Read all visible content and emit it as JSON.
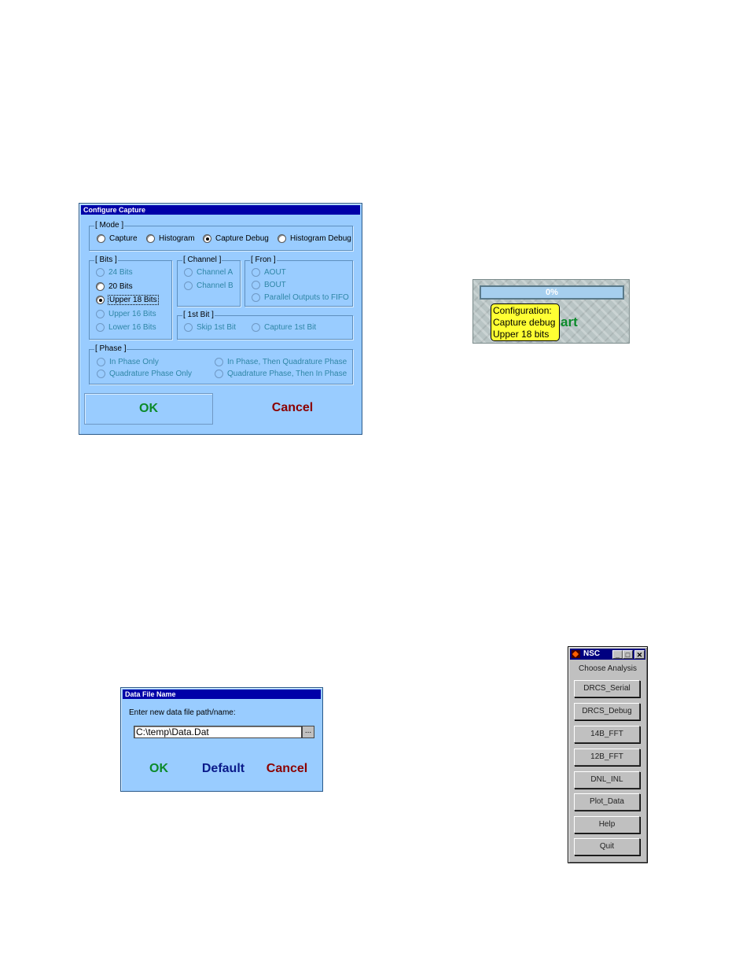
{
  "configure_capture": {
    "title": "Configure Capture",
    "mode": {
      "label": "[ Mode ]",
      "options": [
        {
          "label": "Capture",
          "checked": false
        },
        {
          "label": "Histogram",
          "checked": false
        },
        {
          "label": "Capture Debug",
          "checked": true
        },
        {
          "label": "Histogram Debug",
          "checked": false
        }
      ]
    },
    "bits": {
      "label": "[ Bits ]",
      "options": [
        {
          "label": "24 Bits",
          "enabled": false,
          "checked": false
        },
        {
          "label": "20 Bits",
          "enabled": true,
          "checked": false
        },
        {
          "label": "Upper 18 Bits",
          "enabled": true,
          "checked": true
        },
        {
          "label": "Upper 16 Bits",
          "enabled": false,
          "checked": false
        },
        {
          "label": "Lower 16 Bits",
          "enabled": false,
          "checked": false
        }
      ]
    },
    "channel": {
      "label": "[ Channel ]",
      "options": [
        {
          "label": "Channel A",
          "enabled": false
        },
        {
          "label": "Channel B",
          "enabled": false
        }
      ]
    },
    "from": {
      "label": "[ Fron ]",
      "options": [
        {
          "label": "AOUT",
          "enabled": false
        },
        {
          "label": "BOUT",
          "enabled": false
        },
        {
          "label": "Parallel Outputs to FIFO",
          "enabled": false
        }
      ]
    },
    "first_bit": {
      "label": "[ 1st Bit ]",
      "options": [
        {
          "label": "Skip 1st Bit",
          "enabled": false
        },
        {
          "label": "Capture 1st Bit",
          "enabled": false
        }
      ]
    },
    "phase": {
      "label": "[ Phase ]",
      "options": [
        {
          "label": "In Phase Only",
          "enabled": false
        },
        {
          "label": "Quadrature Phase Only",
          "enabled": false
        },
        {
          "label": "In Phase, Then Quadrature Phase",
          "enabled": false
        },
        {
          "label": "Quadrature Phase, Then In Phase",
          "enabled": false
        }
      ]
    },
    "ok_label": "OK",
    "cancel_label": "Cancel"
  },
  "progress": {
    "percent_text": "0%",
    "progress_value": 0,
    "start_text": "art",
    "tooltip_lines": [
      "Configuration:",
      "Capture debug",
      "Upper 18 bits"
    ]
  },
  "data_file": {
    "title": "Data File Name",
    "prompt": "Enter new data file path/name:",
    "path_value": "C:\\temp\\Data.Dat",
    "browse_label": "...",
    "ok_label": "OK",
    "default_label": "Default",
    "cancel_label": "Cancel"
  },
  "nsc": {
    "title": "NSC",
    "heading": "Choose Analysis",
    "buttons": [
      "DRCS_Serial",
      "DRCS_Debug",
      "14B_FFT",
      "12B_FFT",
      "DNL_INL",
      "Plot_Data",
      "Help",
      "Quit"
    ],
    "window_buttons": {
      "minimize": "_",
      "maximize": "□",
      "close": "✕"
    }
  },
  "colors": {
    "dialog_bg": "#99ccff",
    "title_bar": "#0000a8",
    "ok": "#0b8a2a",
    "cancel": "#8b0000",
    "default": "#0a1a8a",
    "tooltip": "#ffff33"
  }
}
